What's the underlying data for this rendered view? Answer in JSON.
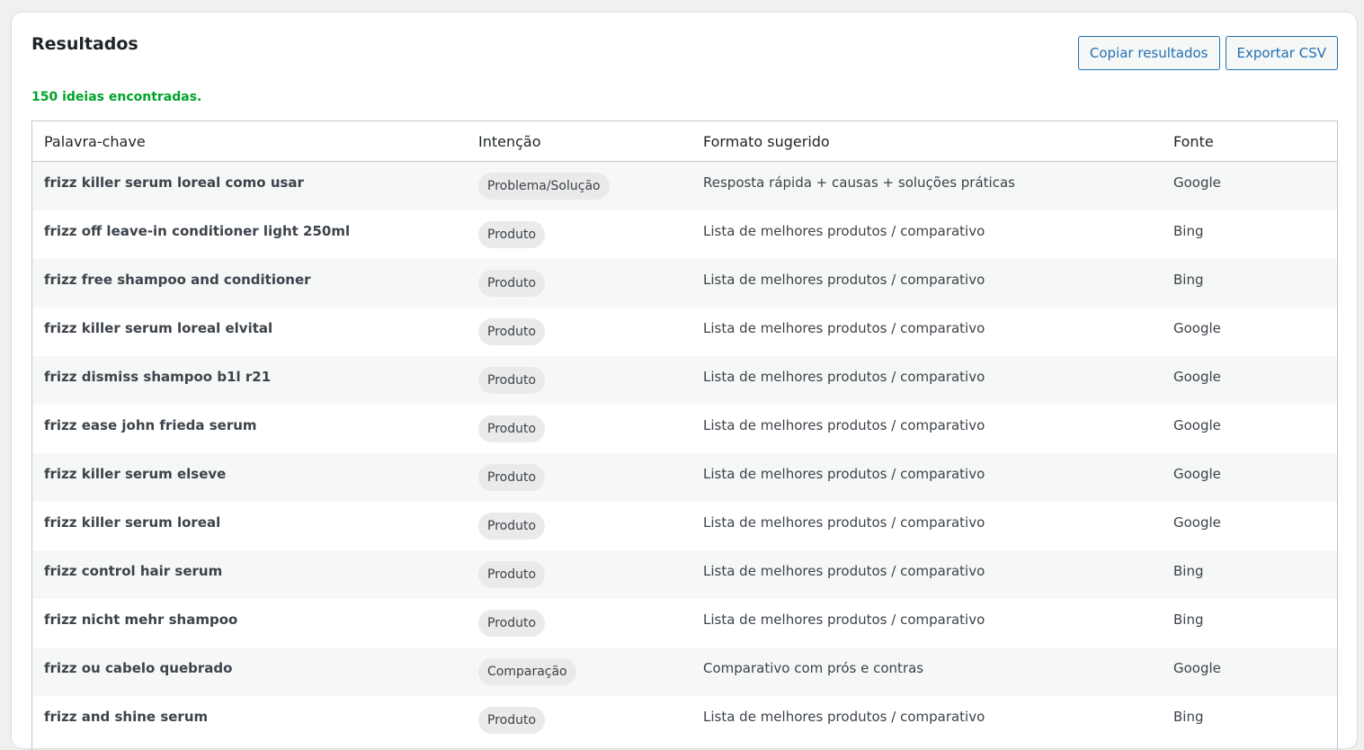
{
  "header": {
    "title": "Resultados",
    "copy_label": "Copiar resultados",
    "export_label": "Exportar CSV"
  },
  "summary": {
    "count_text": "150 ideias encontradas."
  },
  "colors": {
    "accent": "#2271b1",
    "success": "#00a32a"
  },
  "table": {
    "columns": [
      "Palavra-chave",
      "Intenção",
      "Formato sugerido",
      "Fonte"
    ],
    "rows": [
      {
        "keyword": "frizz killer serum loreal como usar",
        "intent": "Problema/Solução",
        "format": "Resposta rápida + causas + soluções práticas",
        "source": "Google"
      },
      {
        "keyword": "frizz off leave-in conditioner light 250ml",
        "intent": "Produto",
        "format": "Lista de melhores produtos / comparativo",
        "source": "Bing"
      },
      {
        "keyword": "frizz free shampoo and conditioner",
        "intent": "Produto",
        "format": "Lista de melhores produtos / comparativo",
        "source": "Bing"
      },
      {
        "keyword": "frizz killer serum loreal elvital",
        "intent": "Produto",
        "format": "Lista de melhores produtos / comparativo",
        "source": "Google"
      },
      {
        "keyword": "frizz dismiss shampoo b1l r21",
        "intent": "Produto",
        "format": "Lista de melhores produtos / comparativo",
        "source": "Google"
      },
      {
        "keyword": "frizz ease john frieda serum",
        "intent": "Produto",
        "format": "Lista de melhores produtos / comparativo",
        "source": "Google"
      },
      {
        "keyword": "frizz killer serum elseve",
        "intent": "Produto",
        "format": "Lista de melhores produtos / comparativo",
        "source": "Google"
      },
      {
        "keyword": "frizz killer serum loreal",
        "intent": "Produto",
        "format": "Lista de melhores produtos / comparativo",
        "source": "Google"
      },
      {
        "keyword": "frizz control hair serum",
        "intent": "Produto",
        "format": "Lista de melhores produtos / comparativo",
        "source": "Bing"
      },
      {
        "keyword": "frizz nicht mehr shampoo",
        "intent": "Produto",
        "format": "Lista de melhores produtos / comparativo",
        "source": "Bing"
      },
      {
        "keyword": "frizz ou cabelo quebrado",
        "intent": "Comparação",
        "format": "Comparativo com prós e contras",
        "source": "Google"
      },
      {
        "keyword": "frizz and shine serum",
        "intent": "Produto",
        "format": "Lista de melhores produtos / comparativo",
        "source": "Bing"
      }
    ]
  }
}
